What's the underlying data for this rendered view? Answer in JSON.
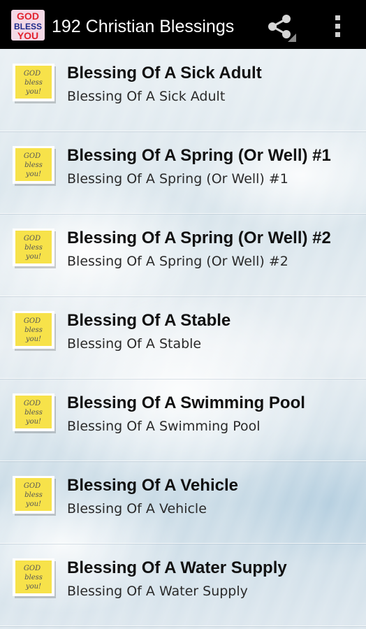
{
  "app": {
    "title": "192 Christian Blessings",
    "logo_text": [
      "GOD",
      "BLESS",
      "YOU"
    ],
    "icons": {
      "logo": "god-bless-you-logo",
      "share": "share-icon",
      "overflow": "overflow-menu-icon",
      "item": "sticky-note-icon"
    },
    "note_text": [
      "GOD",
      "bless",
      "you!"
    ]
  },
  "colors": {
    "action_bar": "#000000",
    "title_text": "#ffffff",
    "item_title": "#111111",
    "item_subtitle": "#2a2a2a",
    "note_yellow": "#f7e24a",
    "logo_red": "#e2222e"
  },
  "items": [
    {
      "title": "Blessing Of A Sick Adult",
      "subtitle": "Blessing Of A Sick Adult"
    },
    {
      "title": "Blessing Of A Spring (Or Well) #1",
      "subtitle": "Blessing Of A Spring (Or Well) #1"
    },
    {
      "title": "Blessing Of A Spring (Or Well) #2",
      "subtitle": "Blessing Of A Spring (Or Well) #2"
    },
    {
      "title": "Blessing Of A Stable",
      "subtitle": "Blessing Of A Stable"
    },
    {
      "title": "Blessing Of A Swimming Pool",
      "subtitle": "Blessing Of A Swimming Pool"
    },
    {
      "title": "Blessing Of A Vehicle",
      "subtitle": "Blessing Of A Vehicle"
    },
    {
      "title": "Blessing Of A Water Supply",
      "subtitle": "Blessing Of A Water Supply"
    }
  ]
}
